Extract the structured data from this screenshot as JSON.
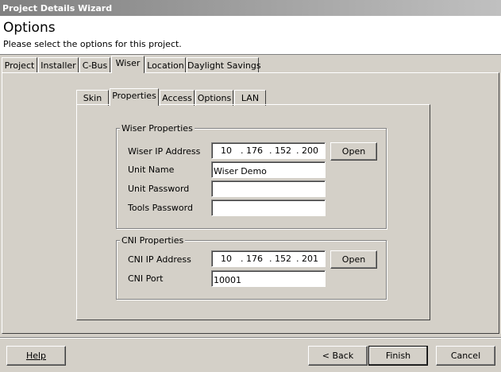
{
  "window": {
    "title": "Project Details Wizard"
  },
  "header": {
    "title": "Options",
    "subtitle": "Please select the options for this project."
  },
  "main_tabs": [
    "Project",
    "Installer",
    "C-Bus",
    "Wiser",
    "Location",
    "Daylight Savings"
  ],
  "main_tabs_active": "Wiser",
  "sub_tabs": [
    "Skin",
    "Properties",
    "Access",
    "Options",
    "LAN"
  ],
  "sub_tabs_active": "Properties",
  "wiser_properties": {
    "legend": "Wiser Properties",
    "ip_label": "Wiser IP Address",
    "ip": [
      "10",
      "176",
      "152",
      "200"
    ],
    "open_label": "Open",
    "unit_name_label": "Unit Name",
    "unit_name_value": "Wiser Demo",
    "unit_password_label": "Unit Password",
    "unit_password_value": "",
    "tools_password_label": "Tools Password",
    "tools_password_value": ""
  },
  "cni_properties": {
    "legend": "CNI Properties",
    "ip_label": "CNI IP Address",
    "ip": [
      "10",
      "176",
      "152",
      "201"
    ],
    "open_label": "Open",
    "port_label": "CNI Port",
    "port_value": "10001"
  },
  "footer": {
    "help_label": "Help",
    "back_label": "< Back",
    "finish_label": "Finish",
    "cancel_label": "Cancel"
  }
}
